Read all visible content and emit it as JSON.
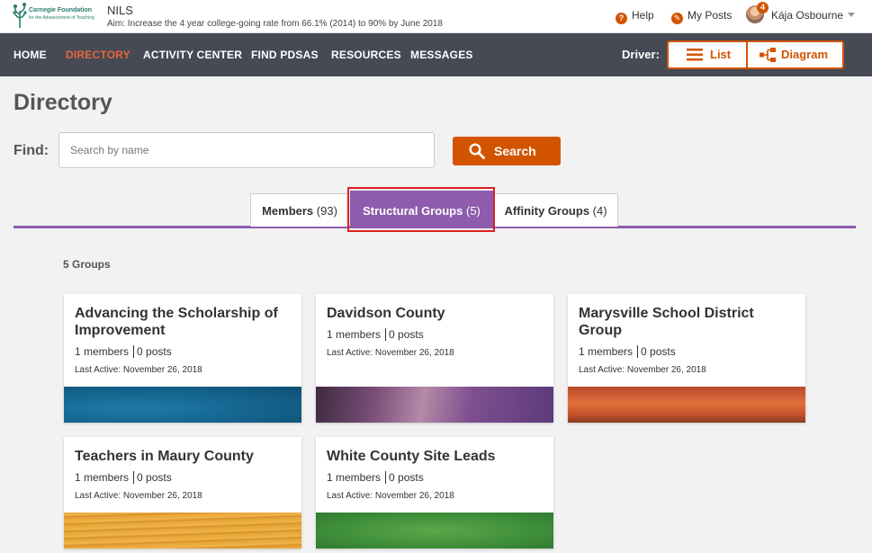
{
  "header": {
    "logo_text": "Carnegie Foundation",
    "logo_sub": "for the Advancement of Teaching",
    "app_name": "NILS",
    "aim": "Aim: Increase the 4 year college-going rate from 66.1% (2014) to 90% by June 2018",
    "help_label": "Help",
    "my_posts_label": "My Posts",
    "notification_count": "4",
    "user_name": "Kája Osbourne"
  },
  "nav": {
    "items": [
      {
        "label": "HOME",
        "active": false
      },
      {
        "label": "DIRECTORY",
        "active": true
      },
      {
        "label": "ACTIVITY CENTER",
        "active": false
      },
      {
        "label": "FIND PDSAS",
        "active": false
      },
      {
        "label": "RESOURCES",
        "active": false
      },
      {
        "label": "MESSAGES",
        "active": false
      }
    ],
    "driver_label": "Driver:",
    "list_label": "List",
    "diagram_label": "Diagram"
  },
  "page": {
    "title": "Directory",
    "find_label": "Find:",
    "search_placeholder": "Search by name",
    "search_button": "Search"
  },
  "tabs": [
    {
      "label": "Members",
      "count": "(93)",
      "active": false
    },
    {
      "label": "Structural Groups",
      "count": "(5)",
      "active": true
    },
    {
      "label": "Affinity Groups",
      "count": "(4)",
      "active": false
    }
  ],
  "groups_count": "5 Groups",
  "groups": [
    {
      "title": "Advancing the Scholarship of Improvement",
      "members": "1 members",
      "posts": "0 posts",
      "last_active": "Last Active: November 26, 2018",
      "image": "ocean-blue"
    },
    {
      "title": "Davidson County",
      "members": "1 members",
      "posts": "0 posts",
      "last_active": "Last Active: November 26, 2018",
      "image": "purple-sky"
    },
    {
      "title": "Marysville School District Group",
      "members": "1 members",
      "posts": "0 posts",
      "last_active": "Last Active: November 26, 2018",
      "image": "orange-sunset"
    },
    {
      "title": "Teachers in Maury County",
      "members": "1 members",
      "posts": "0 posts",
      "last_active": "Last Active: November 26, 2018",
      "image": "wood-grain"
    },
    {
      "title": "White County Site Leads",
      "members": "1 members",
      "posts": "0 posts",
      "last_active": "Last Active: November 26, 2018",
      "image": "green-grass"
    }
  ],
  "colors": {
    "accent": "#d35400",
    "nav_bg": "#464a54",
    "tab_active": "#8e5bad",
    "highlight": "#e02020"
  }
}
